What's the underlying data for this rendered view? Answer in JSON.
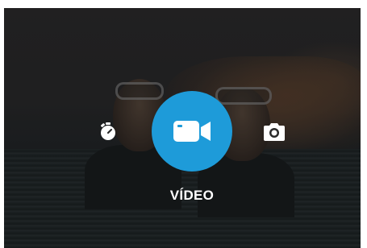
{
  "mode_selector": {
    "active_mode_label": "VÍDEO",
    "modes": [
      {
        "id": "timer",
        "icon": "stopwatch-icon"
      },
      {
        "id": "video",
        "icon": "video-camera-icon",
        "active": true
      },
      {
        "id": "photo",
        "icon": "camera-icon"
      }
    ]
  },
  "colors": {
    "accent": "#1e9bd9",
    "icon": "#ffffff"
  }
}
